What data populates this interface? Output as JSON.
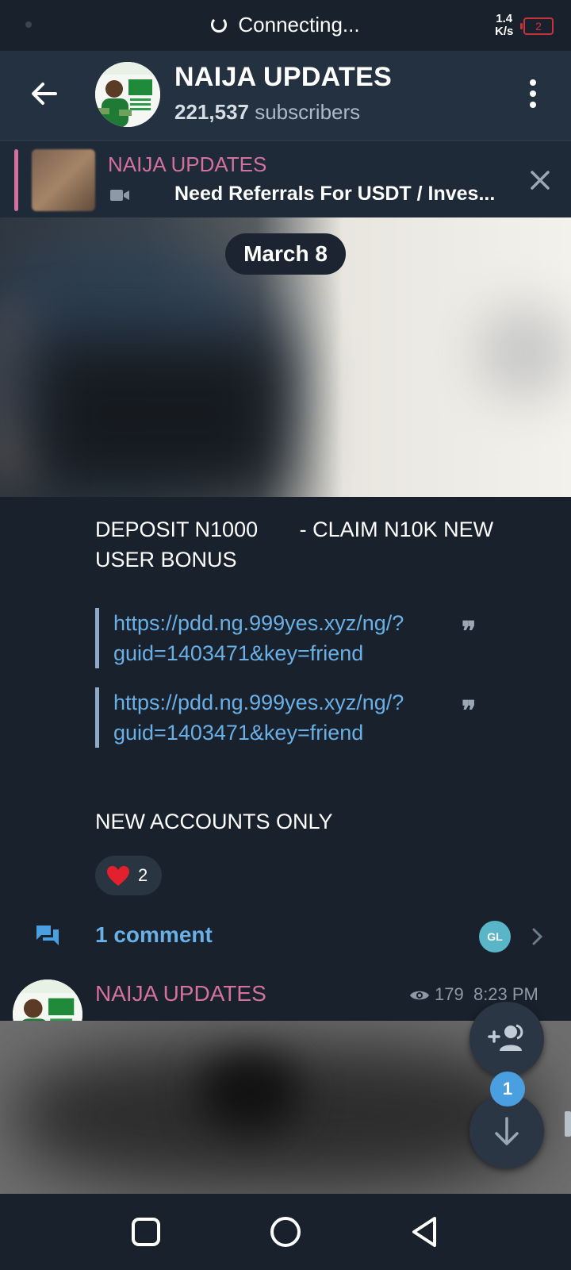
{
  "status_bar": {
    "connection_text": "Connecting...",
    "net_speed_value": "1.4",
    "net_speed_unit": "K/s",
    "battery_level": "2"
  },
  "header": {
    "title": "NAIJA UPDATES",
    "subscriber_count": "221,537",
    "subscriber_label": "subscribers"
  },
  "pinned": {
    "title": "NAIJA UPDATES",
    "text": "Need Referrals For USDT / Inves..."
  },
  "date_label": "March 8",
  "post": {
    "line1": "DEPOSIT N1000       - CLAIM N10K NEW",
    "line2": "USER BONUS",
    "quote1_line1": "https://pdd.ng.999yes.xyz/ng/?",
    "quote1_line2": "guid=1403471&key=friend",
    "quote2_line1": "https://pdd.ng.999yes.xyz/ng/?",
    "quote2_line2": "guid=1403471&key=friend",
    "footer_text": "NEW ACCOUNTS ONLY",
    "reaction_count": "2",
    "comment_label": "1 comment",
    "commenter_initials": "GL"
  },
  "post2": {
    "author": "NAIJA UPDATES",
    "views": "179",
    "time": "8:23 PM"
  },
  "fab": {
    "unread_badge": "1"
  },
  "colors": {
    "background": "#18212c",
    "header": "#243140",
    "accent_pink": "#d4719c",
    "link_blue": "#6ab0e6",
    "badge_blue": "#4a9fe0"
  },
  "icons": [
    "back-arrow-icon",
    "more-vert-icon",
    "video-icon",
    "close-icon",
    "quote-icon",
    "heart-icon",
    "comments-icon",
    "chevron-right-icon",
    "eye-icon",
    "add-member-icon",
    "arrow-down-icon",
    "nav-recents-icon",
    "nav-home-icon",
    "nav-back-icon"
  ]
}
